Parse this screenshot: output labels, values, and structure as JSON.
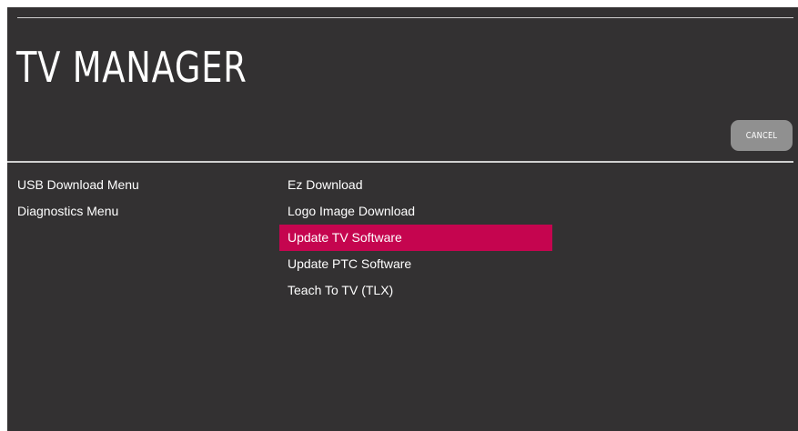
{
  "header": {
    "title": "TV MANAGER"
  },
  "actions": {
    "cancel_label": "CANCEL"
  },
  "left_menu": {
    "items": [
      {
        "label": "USB Download Menu"
      },
      {
        "label": "Diagnostics Menu"
      }
    ]
  },
  "right_menu": {
    "items": [
      {
        "label": "Ez Download",
        "selected": false
      },
      {
        "label": "Logo Image Download",
        "selected": false
      },
      {
        "label": "Update TV Software",
        "selected": true
      },
      {
        "label": "Update PTC Software",
        "selected": false
      },
      {
        "label": "Teach To TV (TLX)",
        "selected": false
      }
    ]
  },
  "colors": {
    "background": "#333132",
    "highlight": "#c5054f",
    "cancel_button": "#909090",
    "text": "#ffffff"
  }
}
